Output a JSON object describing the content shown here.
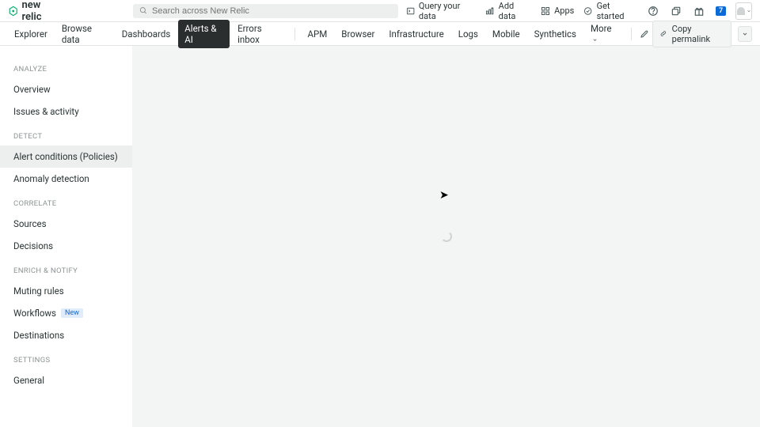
{
  "brand": "new relic",
  "search": {
    "placeholder": "Search across New Relic"
  },
  "top_links": {
    "query": "Query your data",
    "add": "Add data",
    "apps": "Apps",
    "get_started": "Get started"
  },
  "notif_count": "7",
  "nav": {
    "explorer": "Explorer",
    "browse": "Browse data",
    "dashboards": "Dashboards",
    "alerts": "Alerts & AI",
    "errors": "Errors inbox",
    "apm": "APM",
    "browser": "Browser",
    "infra": "Infrastructure",
    "logs": "Logs",
    "mobile": "Mobile",
    "synthetics": "Synthetics",
    "more": "More"
  },
  "copy_permalink": "Copy permalink",
  "sidebar": {
    "analyze": {
      "header": "ANALYZE",
      "overview": "Overview",
      "issues": "Issues & activity"
    },
    "detect": {
      "header": "DETECT",
      "conditions": "Alert conditions (Policies)",
      "anomaly": "Anomaly detection"
    },
    "correlate": {
      "header": "CORRELATE",
      "sources": "Sources",
      "decisions": "Decisions"
    },
    "enrich": {
      "header": "ENRICH & NOTIFY",
      "muting": "Muting rules",
      "workflows": "Workflows",
      "new_badge": "New",
      "destinations": "Destinations"
    },
    "settings": {
      "header": "SETTINGS",
      "general": "General"
    }
  }
}
